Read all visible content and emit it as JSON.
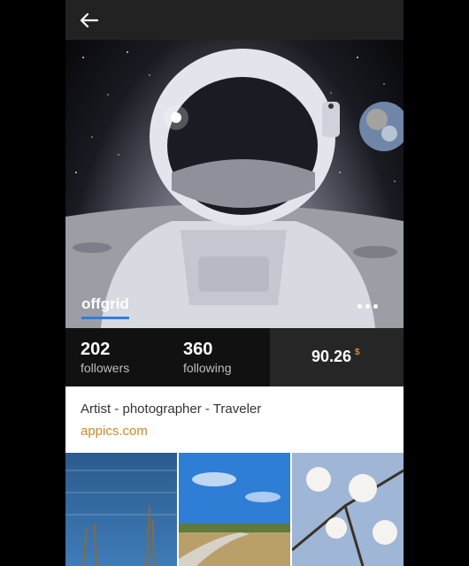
{
  "topbar": {
    "back_icon": "arrow-left-icon"
  },
  "profile": {
    "username": "offgrid",
    "more_icon": "more-horizontal-icon",
    "bio": "Artist - photographer - Traveler",
    "website": "appics.com"
  },
  "stats": {
    "followers_count": "202",
    "followers_label": "followers",
    "following_count": "360",
    "following_label": "following",
    "balance": "90.26",
    "currency": "$"
  },
  "colors": {
    "accent_orange": "#d0872c",
    "underline_blue": "#2d7fe0",
    "topbar": "#222222",
    "stats_dark": "#111111",
    "stats_balance": "#262626"
  },
  "gallery": {
    "items": [
      {
        "icon": "lake-reeds-photo"
      },
      {
        "icon": "boardwalk-sky-photo"
      },
      {
        "icon": "magnolia-blossom-photo"
      }
    ]
  }
}
